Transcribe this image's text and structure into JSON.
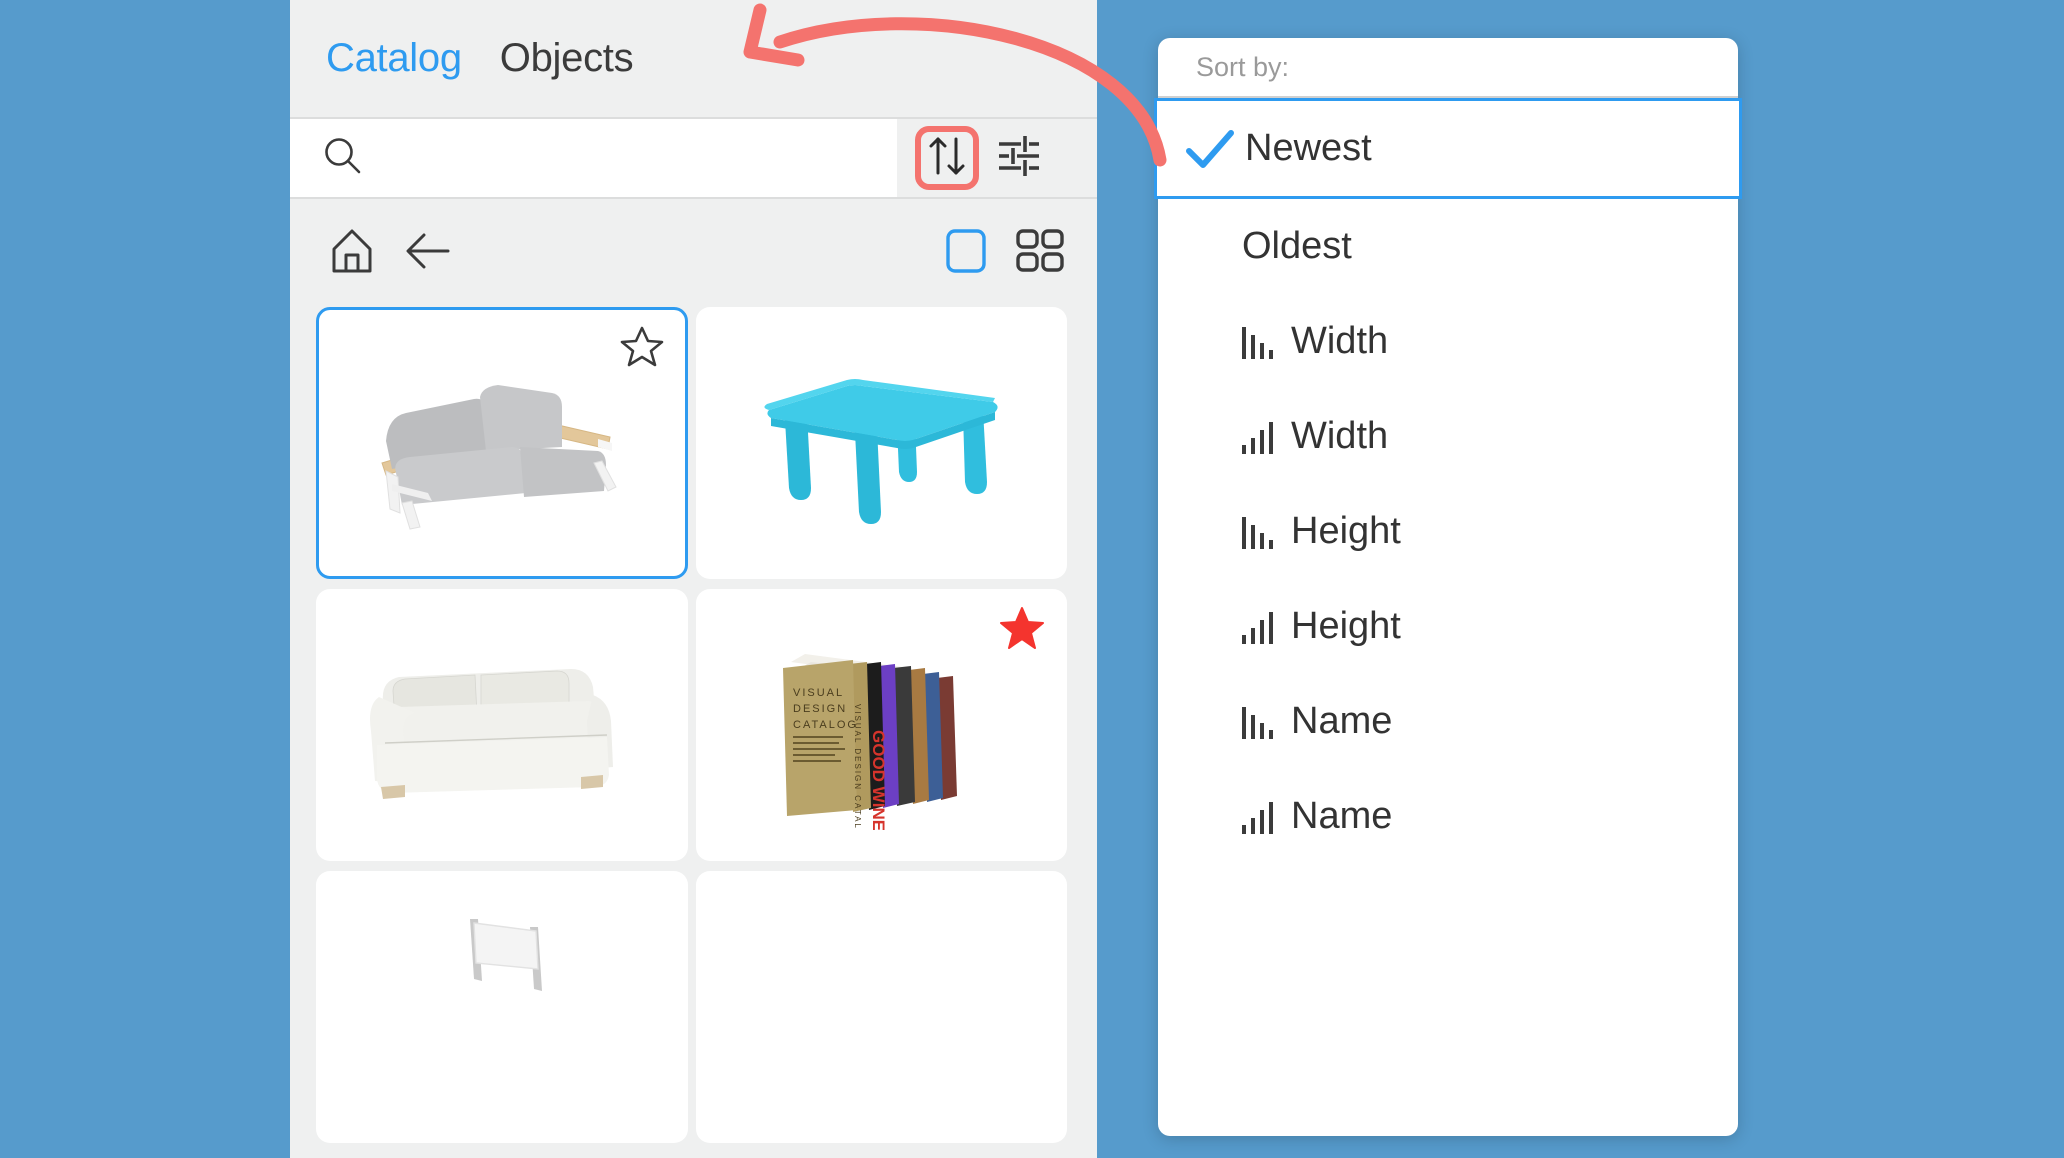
{
  "theme": {
    "background_color": "#569bcc",
    "panel_color": "#eff0f0",
    "accent_blue": "#2e9bf0",
    "annotation_red": "#f4736e",
    "star_red": "#f4342e",
    "text_dark": "#3b3b3b",
    "text_muted": "#9a9a9a"
  },
  "catalog_panel": {
    "tabs": [
      {
        "label": "Catalog",
        "active": true,
        "name": "tab-catalog"
      },
      {
        "label": "Objects",
        "active": false,
        "name": "tab-objects"
      }
    ],
    "search": {
      "value": "",
      "placeholder": "",
      "icon": "search-icon"
    },
    "search_actions": [
      {
        "name": "sort-button",
        "icon": "sort-arrows-icon",
        "highlighted": true
      },
      {
        "name": "filter-button",
        "icon": "sliders-filter-icon",
        "highlighted": false
      }
    ],
    "nav": {
      "left": [
        {
          "name": "home-button",
          "icon": "home-icon"
        },
        {
          "name": "back-button",
          "icon": "arrow-left-icon"
        }
      ],
      "right": [
        {
          "name": "list-view-toggle",
          "icon": "single-pane-icon",
          "active": true
        },
        {
          "name": "grid-view-toggle",
          "icon": "grid-four-icon",
          "active": false
        }
      ]
    },
    "items": [
      {
        "name": "catalog-item-gray-sofa",
        "thumbnail": "gray-sofa-wood-arms",
        "selected": true,
        "favorite": false,
        "star_icon": "star-outline-icon"
      },
      {
        "name": "catalog-item-turquoise-table",
        "thumbnail": "turquoise-kids-table",
        "selected": false,
        "favorite": false,
        "star_icon": ""
      },
      {
        "name": "catalog-item-white-sofa",
        "thumbnail": "white-upholstered-sofa",
        "selected": false,
        "favorite": false,
        "star_icon": ""
      },
      {
        "name": "catalog-item-books",
        "thumbnail": "row-of-books",
        "selected": false,
        "favorite": true,
        "star_icon": "star-filled-icon"
      },
      {
        "name": "catalog-item-white-chair",
        "thumbnail": "white-chair",
        "selected": false,
        "favorite": false,
        "star_icon": ""
      },
      {
        "name": "catalog-item-empty",
        "thumbnail": "",
        "selected": false,
        "favorite": false,
        "star_icon": ""
      }
    ]
  },
  "sort_dropdown": {
    "header_label": "Sort by:",
    "options": [
      {
        "label": "Newest",
        "icon": "",
        "selected": true,
        "name": "sort-option-newest"
      },
      {
        "label": "Oldest",
        "icon": "",
        "selected": false,
        "name": "sort-option-oldest"
      },
      {
        "label": "Width",
        "icon": "bars-descending-icon",
        "selected": false,
        "name": "sort-option-width-desc"
      },
      {
        "label": "Width",
        "icon": "bars-ascending-icon",
        "selected": false,
        "name": "sort-option-width-asc"
      },
      {
        "label": "Height",
        "icon": "bars-descending-icon",
        "selected": false,
        "name": "sort-option-height-desc"
      },
      {
        "label": "Height",
        "icon": "bars-ascending-icon",
        "selected": false,
        "name": "sort-option-height-asc"
      },
      {
        "label": "Name",
        "icon": "bars-descending-icon",
        "selected": false,
        "name": "sort-option-name-desc"
      },
      {
        "label": "Name",
        "icon": "bars-ascending-icon",
        "selected": false,
        "name": "sort-option-name-asc"
      }
    ]
  },
  "annotation": {
    "type": "curved-arrow",
    "color": "#f4736e",
    "points_to": "sort-button",
    "originates_from": "sort-dropdown"
  }
}
